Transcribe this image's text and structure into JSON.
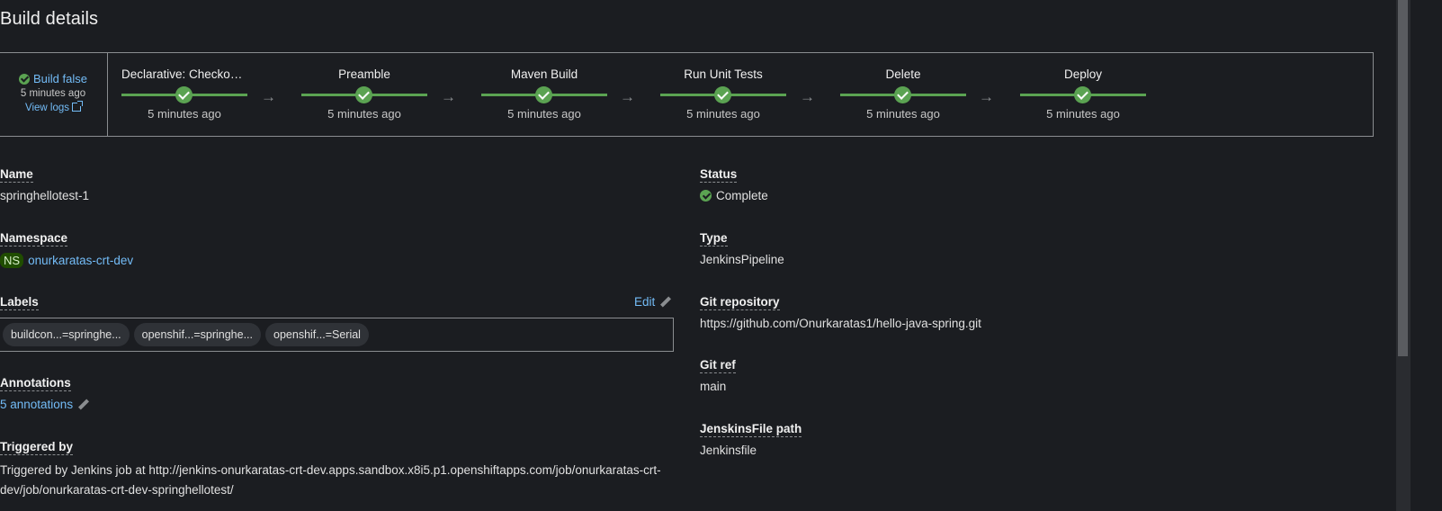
{
  "page": {
    "title": "Build details"
  },
  "pipeline": {
    "summary": {
      "status": "Build false",
      "time": "5 minutes ago",
      "logs_label": "View logs"
    },
    "stages": [
      {
        "name": "Declarative: Checkout ...",
        "time": "5 minutes ago"
      },
      {
        "name": "Preamble",
        "time": "5 minutes ago"
      },
      {
        "name": "Maven Build",
        "time": "5 minutes ago"
      },
      {
        "name": "Run Unit Tests",
        "time": "5 minutes ago"
      },
      {
        "name": "Delete",
        "time": "5 minutes ago"
      },
      {
        "name": "Deploy",
        "time": "5 minutes ago"
      }
    ],
    "arrow_glyph": "→",
    "status_color": "#5ba352"
  },
  "details": {
    "name": {
      "label": "Name",
      "value": "springhellotest-1"
    },
    "namespace": {
      "label": "Namespace",
      "badge": "NS",
      "value": "onurkaratas-crt-dev"
    },
    "labels": {
      "label": "Labels",
      "edit_label": "Edit",
      "chips": [
        "buildcon...=springhe...",
        "openshif...=springhe...",
        "openshif...=Serial"
      ]
    },
    "annotations": {
      "label": "Annotations",
      "value": "5 annotations"
    },
    "triggered_by": {
      "label": "Triggered by",
      "value": "Triggered by Jenkins job at http://jenkins-onurkaratas-crt-dev.apps.sandbox.x8i5.p1.openshiftapps.com/job/onurkaratas-crt-dev/job/onurkaratas-crt-dev-springhellotest/"
    },
    "status": {
      "label": "Status",
      "value": "Complete"
    },
    "type": {
      "label": "Type",
      "value": "JenkinsPipeline"
    },
    "git_repository": {
      "label": "Git repository",
      "value": "https://github.com/Onurkaratas1/hello-java-spring.git"
    },
    "git_ref": {
      "label": "Git ref",
      "value": "main"
    },
    "jenkinsfile_path": {
      "label": "JenskinsFile path",
      "value": "Jenkinsfile"
    }
  },
  "colors": {
    "background": "#1b1d21",
    "link": "#73bcf7",
    "success": "#5ba352",
    "border": "#8a8d90"
  }
}
